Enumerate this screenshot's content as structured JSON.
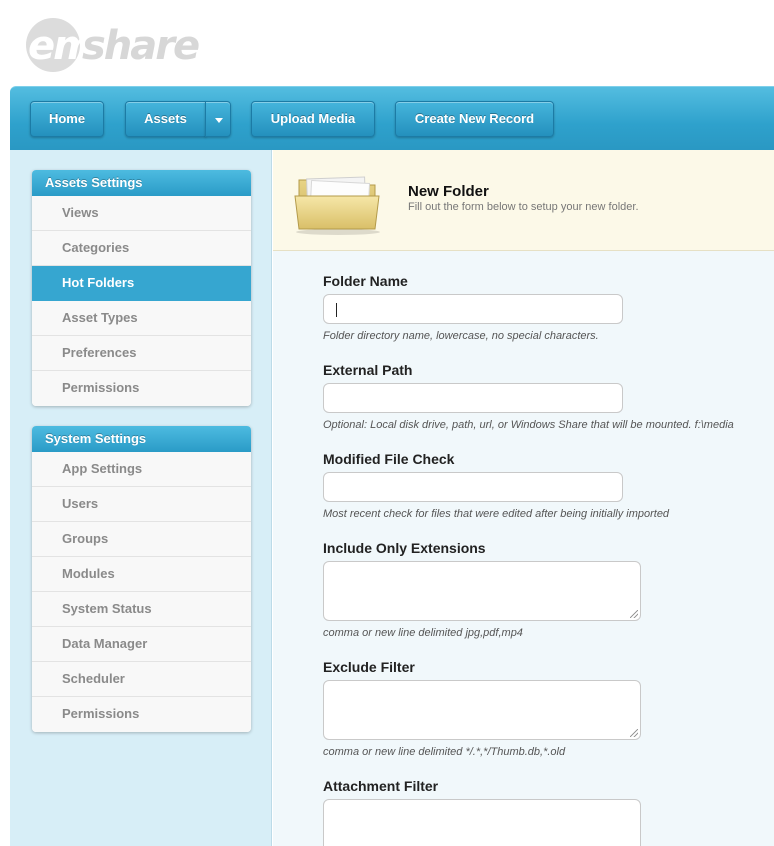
{
  "logo": {
    "em": "em",
    "share": "share"
  },
  "nav": {
    "home": "Home",
    "assets": "Assets",
    "upload_media": "Upload Media",
    "create_new_record": "Create New Record"
  },
  "sidebar": {
    "assets_settings": {
      "title": "Assets Settings",
      "items": [
        "Views",
        "Categories",
        "Hot Folders",
        "Asset Types",
        "Preferences",
        "Permissions"
      ],
      "active": "Hot Folders"
    },
    "system_settings": {
      "title": "System Settings",
      "items": [
        "App Settings",
        "Users",
        "Groups",
        "Modules",
        "System Status",
        "Data Manager",
        "Scheduler",
        "Permissions"
      ]
    }
  },
  "page": {
    "title": "New Folder",
    "subtitle": "Fill out the form below to setup your new folder."
  },
  "form": {
    "folder_name": {
      "label": "Folder Name",
      "value": "",
      "help": "Folder directory name, lowercase, no special characters."
    },
    "external_path": {
      "label": "External Path",
      "value": "",
      "help": "Optional: Local disk drive, path, url, or Windows Share that will be mounted. f:\\media"
    },
    "modified_file_check": {
      "label": "Modified File Check",
      "value": "",
      "help": "Most recent check for files that were edited after being initially imported"
    },
    "include_only_extensions": {
      "label": "Include Only Extensions",
      "value": "",
      "help": "comma or new line delimited jpg,pdf,mp4"
    },
    "exclude_filter": {
      "label": "Exclude Filter",
      "value": "",
      "help": "comma or new line delimited */.*,*/Thumb.db,*.old"
    },
    "attachment_filter": {
      "label": "Attachment Filter",
      "value": ""
    }
  },
  "colors": {
    "nav_blue": "#2ea1cc",
    "sidebar_bg": "#d7eef7",
    "active_item": "#36a6d0",
    "header_bg": "#fcf9e8"
  }
}
